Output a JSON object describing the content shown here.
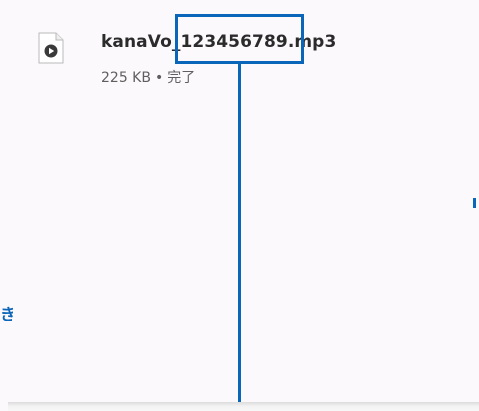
{
  "download": {
    "filename": "kanaVo_123456789.mp3",
    "size": "225 KB",
    "separator": "•",
    "status": "完了"
  },
  "annotation": {
    "color": "#0a66b8",
    "left_fragment": "き"
  },
  "icons": {
    "file": "audio-file-icon"
  },
  "colors": {
    "background": "#fcf9fd",
    "text": "#2b2b2b",
    "meta_text": "#5f5f5f"
  }
}
